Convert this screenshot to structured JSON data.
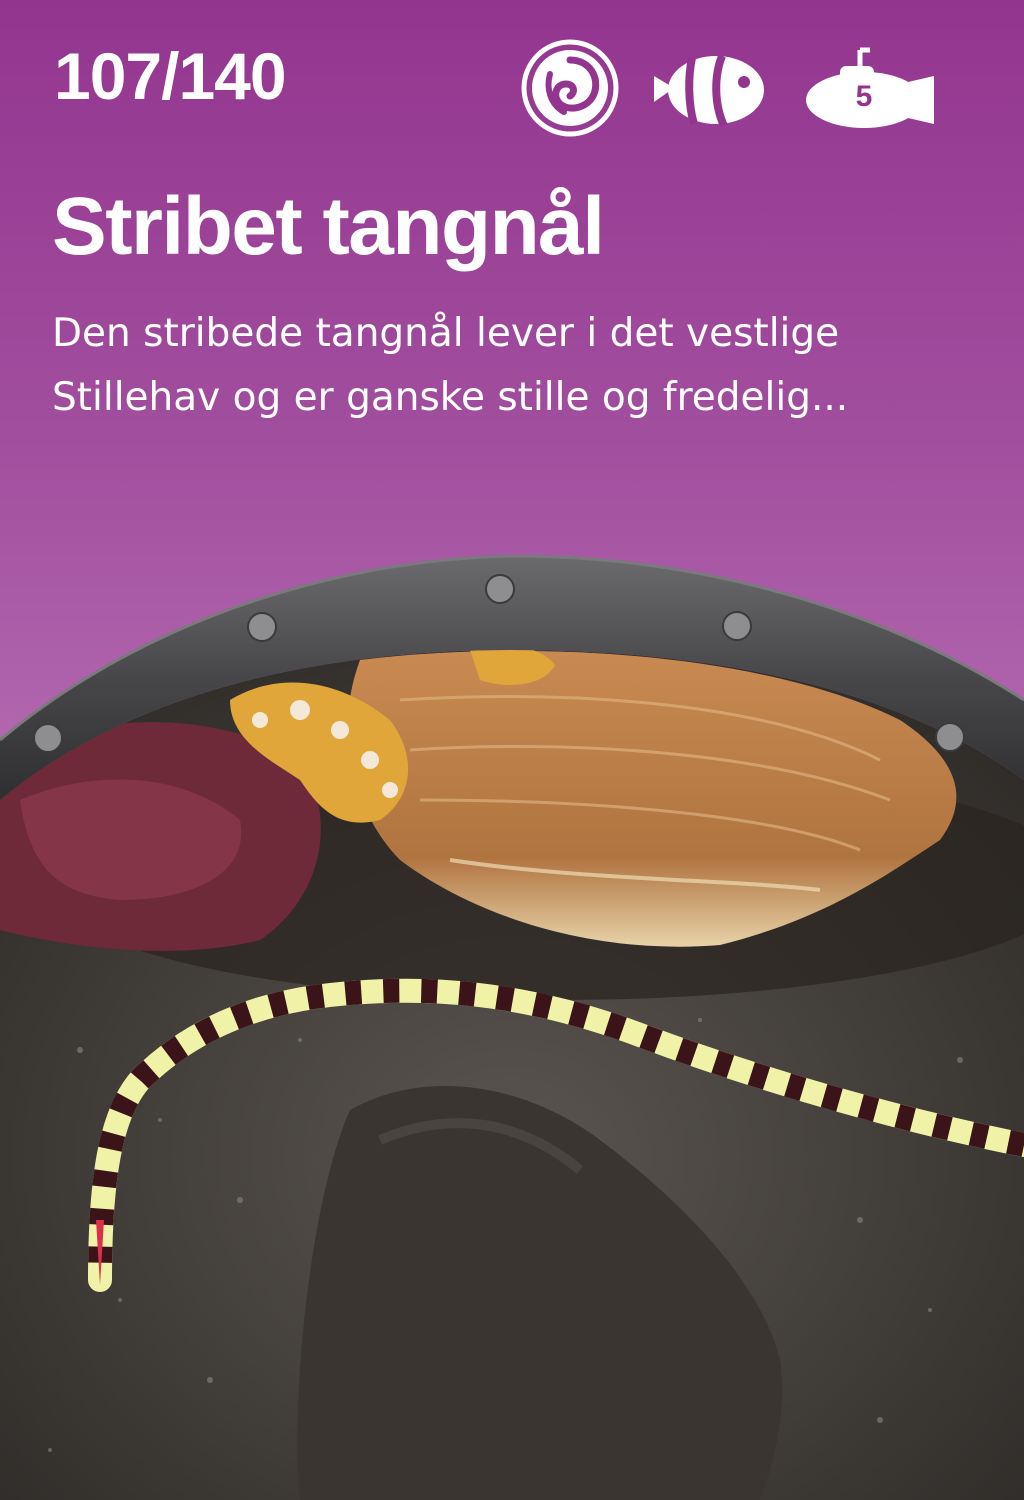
{
  "card": {
    "counter": "107/140",
    "title": "Stribet tangnål",
    "description_line1": "Den stribede tangnål lever i det vestlige",
    "description_line2": "Stillehav og er ganske stille og fredelig..."
  },
  "icons": {
    "habitat": "spiral-shell-icon",
    "category": "clownfish-icon",
    "depth": "submarine-icon",
    "depth_level": "5"
  },
  "colors": {
    "background_top": "#93358f",
    "background_bottom": "#c487bf",
    "text": "#ffffff",
    "porthole_frame": "#4a4a4c"
  }
}
